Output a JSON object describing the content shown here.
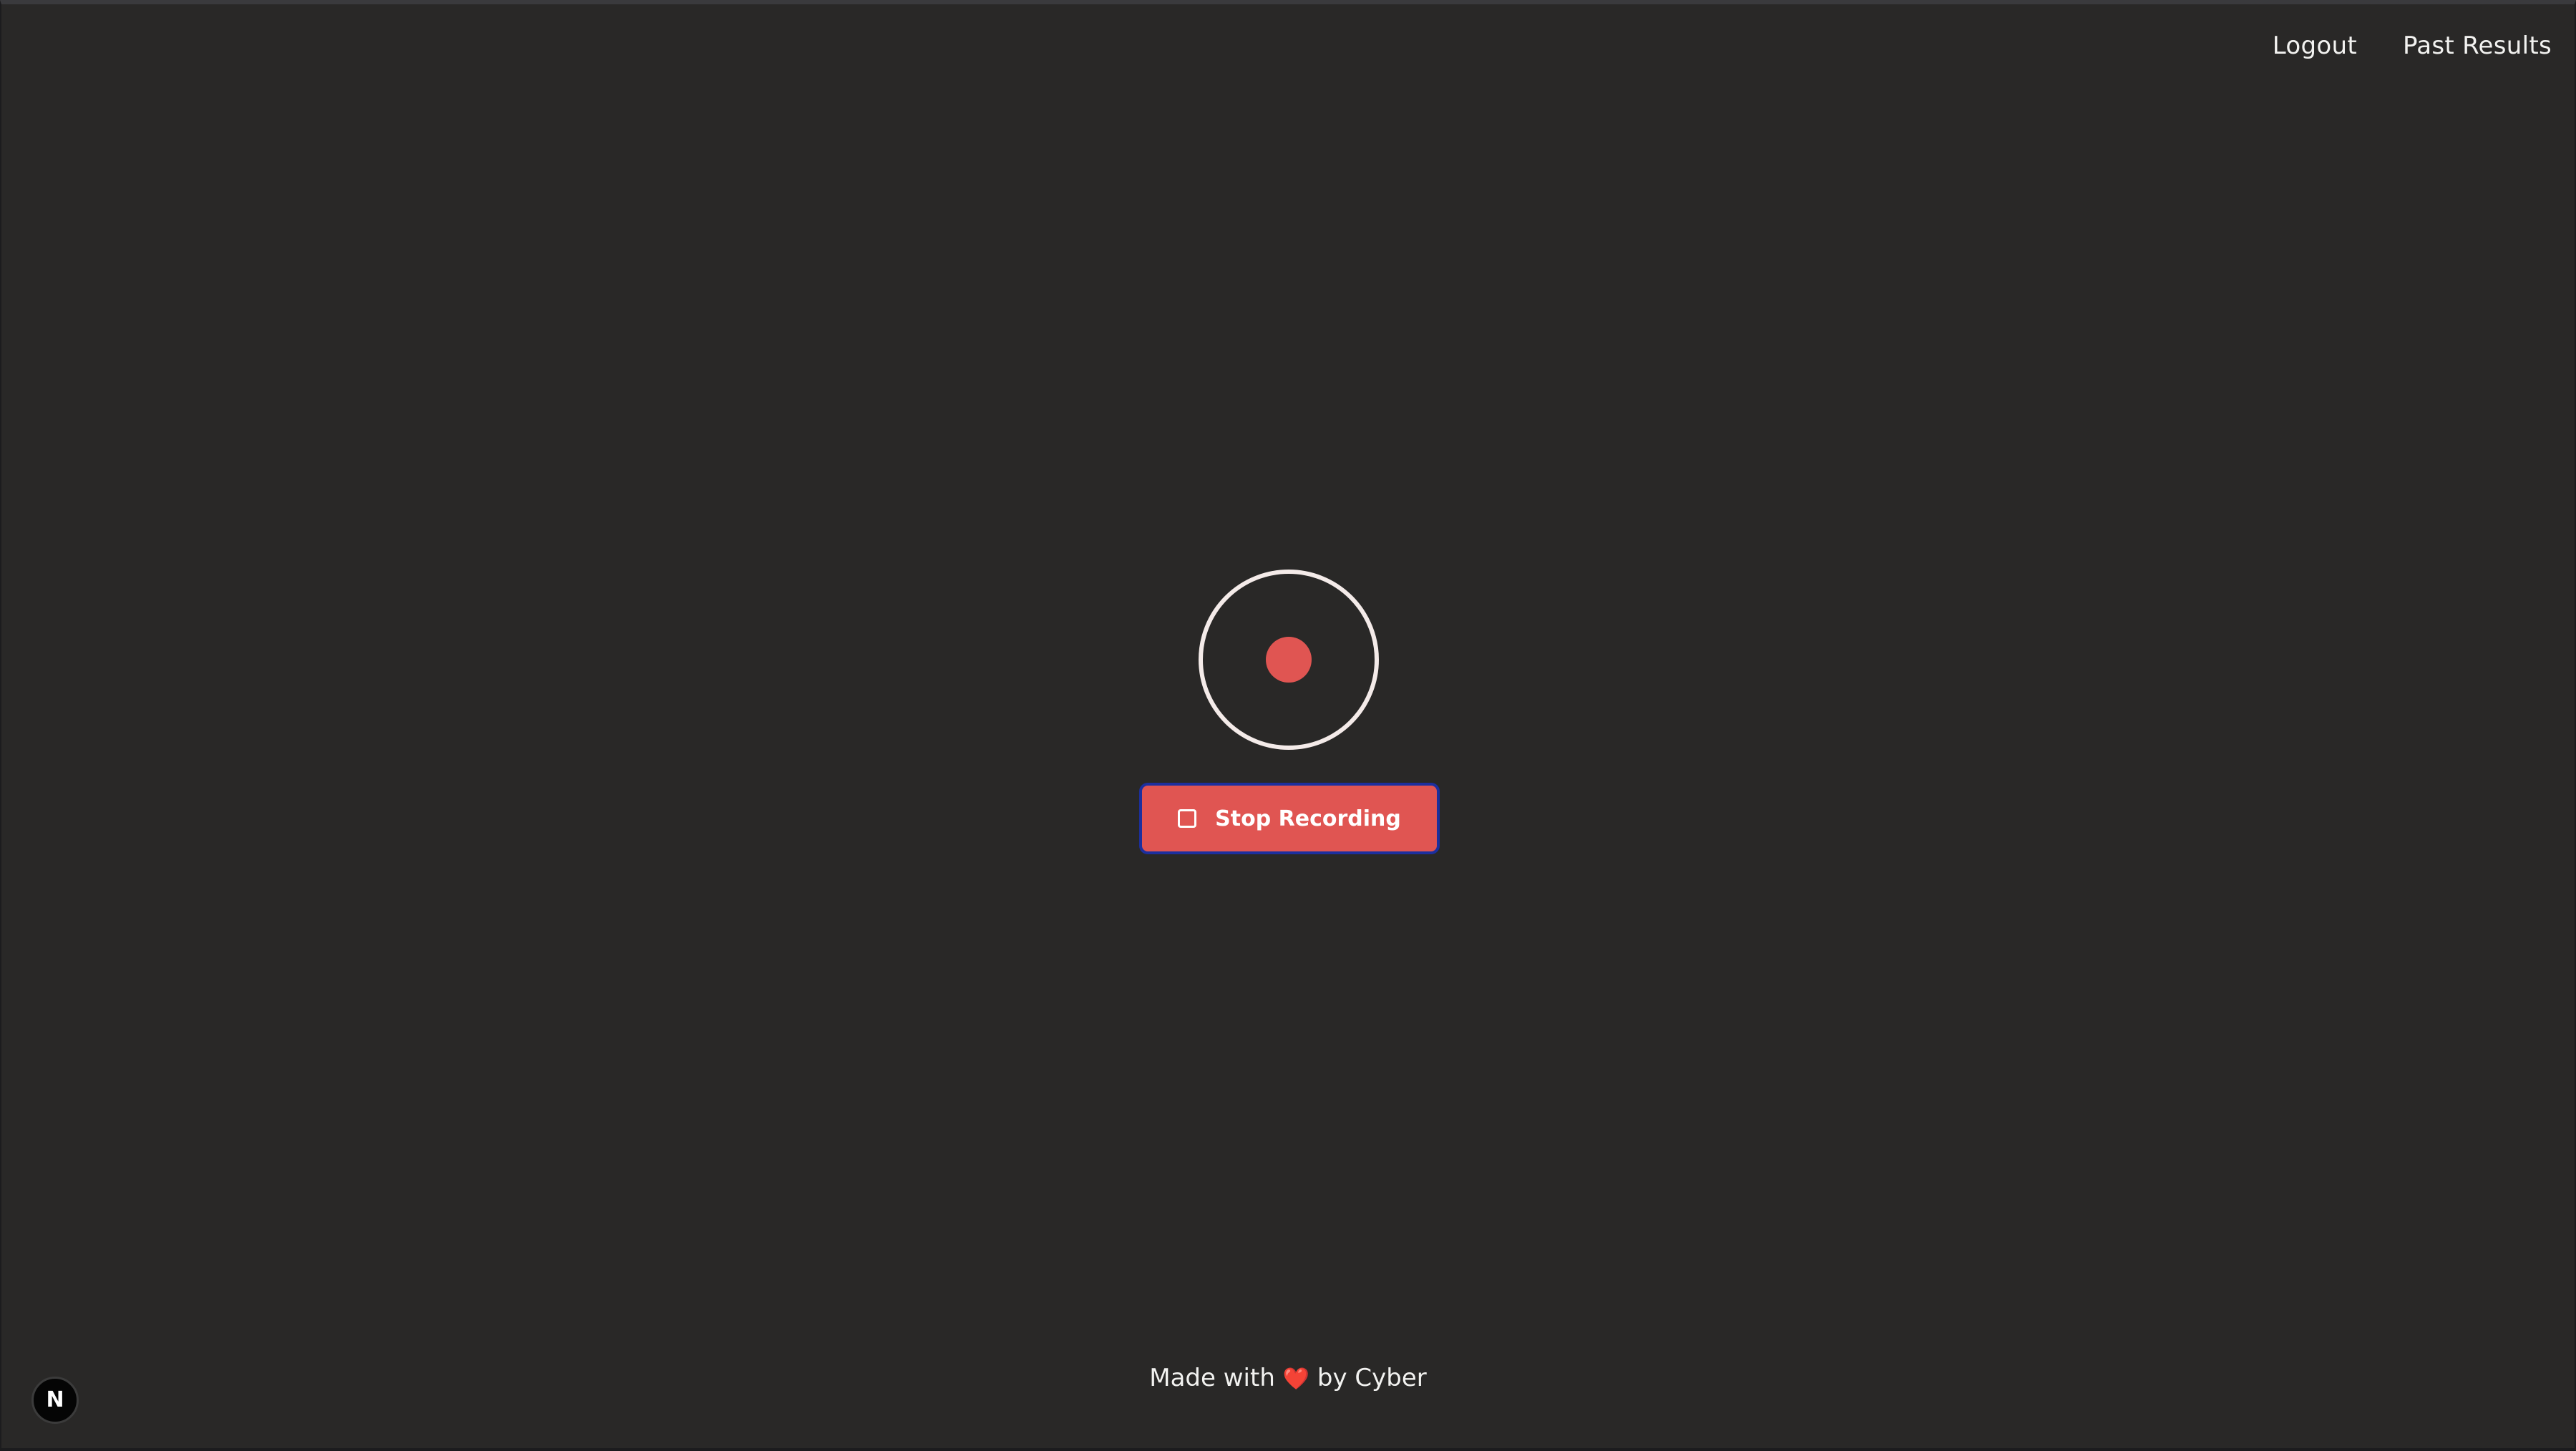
{
  "header": {
    "nav": [
      {
        "label": "Logout"
      },
      {
        "label": "Past Results"
      }
    ]
  },
  "recorder": {
    "state_icon": "record-dot-icon",
    "stop_button": {
      "label": "Stop Recording",
      "icon": "stop-square-icon"
    }
  },
  "footer": {
    "made_with": "Made with",
    "heart": "❤️",
    "by": "by Cyber"
  },
  "dev_badge": {
    "label": "N",
    "icon": "nextjs-logo-icon"
  },
  "colors": {
    "background": "#292827",
    "accent_red": "#e05552",
    "focus_ring": "#1c2f9e",
    "ring": "#f4ebe9"
  }
}
